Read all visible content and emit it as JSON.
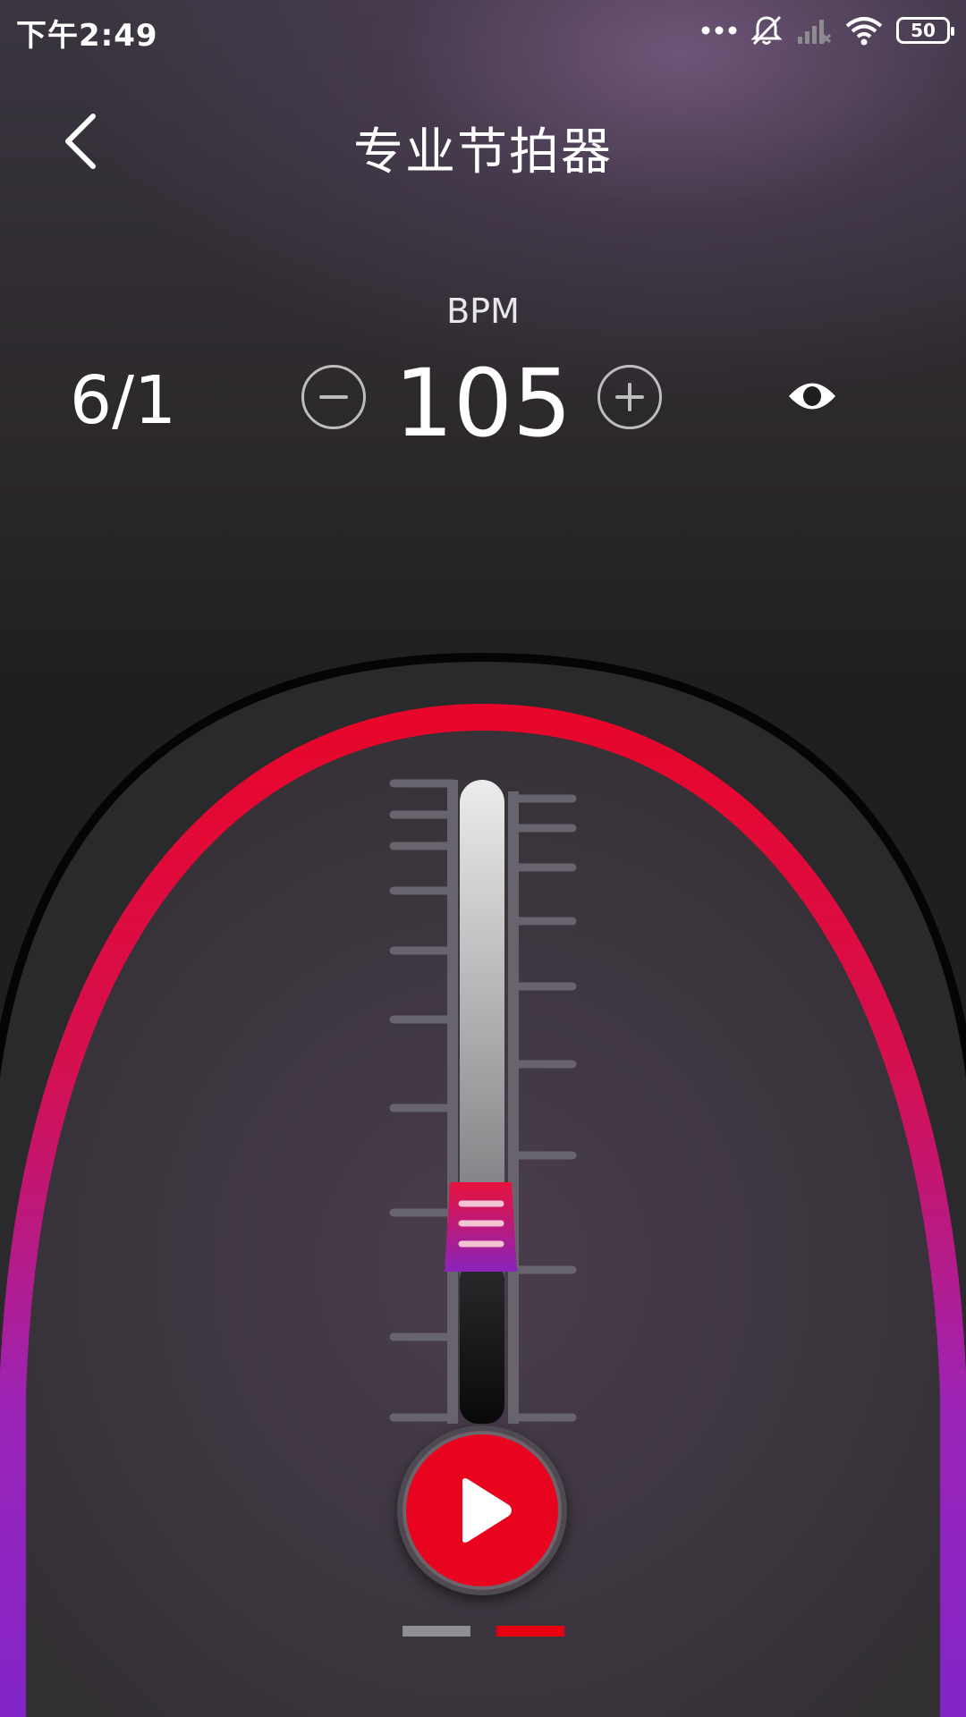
{
  "status_bar": {
    "time": "下午2:49",
    "battery": "50",
    "icons": [
      "more-dots-icon",
      "mute-icon",
      "cell-signal-off-icon",
      "wifi-icon",
      "battery-icon"
    ]
  },
  "header": {
    "title": "专业节拍器",
    "back_icon": "chevron-left-icon"
  },
  "tempo": {
    "label": "BPM",
    "value": "105",
    "time_signature": "6/1",
    "minus_icon": "minus-circle-icon",
    "plus_icon": "plus-circle-icon",
    "visual_icon": "eye-icon"
  },
  "metronome": {
    "slider_level": 0.26,
    "play_icon": "play-icon",
    "pages": 2,
    "active_page": 2
  },
  "colors": {
    "accent_red": "#e8041f",
    "arc_purple": "#8a2ac8",
    "page_active": "#e80012",
    "page_inactive": "#8f8e92"
  }
}
